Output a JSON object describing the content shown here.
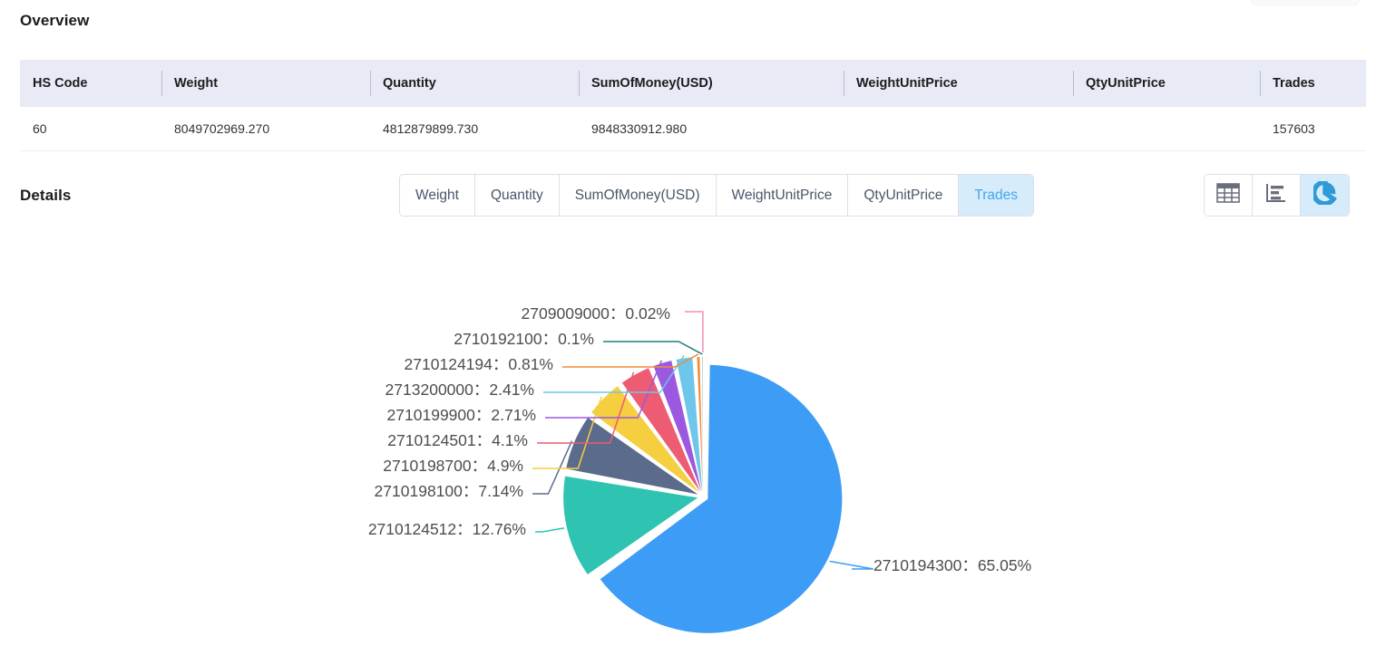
{
  "overview": {
    "title": "Overview",
    "columns": [
      "HS Code",
      "Weight",
      "Quantity",
      "SumOfMoney(USD)",
      "WeightUnitPrice",
      "QtyUnitPrice",
      "Trades"
    ],
    "rows": [
      {
        "hs_code": "60",
        "weight": "8049702969.270",
        "quantity": "4812879899.730",
        "sum_of_money_usd": "9848330912.980",
        "weight_unit_price": "",
        "qty_unit_price": "",
        "trades": "157603"
      }
    ]
  },
  "details": {
    "title": "Details",
    "metric_tabs": [
      {
        "label": "Weight",
        "active": false
      },
      {
        "label": "Quantity",
        "active": false
      },
      {
        "label": "SumOfMoney(USD)",
        "active": false
      },
      {
        "label": "WeightUnitPrice",
        "active": false
      },
      {
        "label": "QtyUnitPrice",
        "active": false
      },
      {
        "label": "Trades",
        "active": true
      }
    ],
    "view_modes": [
      {
        "icon": "table-view-icon",
        "active": false
      },
      {
        "icon": "bar-chart-view-icon",
        "active": false
      },
      {
        "icon": "pie-chart-view-icon",
        "active": true
      }
    ],
    "active_color": "#45a7e8",
    "active_bg": "#d6ecfb"
  },
  "chart_data": {
    "type": "pie",
    "title": "",
    "metric": "Trades",
    "unit": "%",
    "legend_position": "labels-with-leader-lines",
    "categories": [
      "2710194300",
      "2710124512",
      "2710198100",
      "2710198700",
      "2710124501",
      "2710199900",
      "2713200000",
      "2710124194",
      "2710192100",
      "2709009000"
    ],
    "values": [
      65.05,
      12.76,
      7.14,
      4.9,
      4.1,
      2.71,
      2.41,
      0.81,
      0.1,
      0.02
    ],
    "colors": [
      "#3d9cf5",
      "#2fc4b2",
      "#5b6b8c",
      "#f5cf3f",
      "#ed5c72",
      "#9b59e0",
      "#6ec6ea",
      "#f08c3a",
      "#18807c",
      "#f48fb1"
    ],
    "labels": [
      "2710194300：65.05%",
      "2710124512：12.76%",
      "2710198100：7.14%",
      "2710198700：4.9%",
      "2710124501：4.1%",
      "2710199900：2.71%",
      "2713200000：2.41%",
      "2710124194：0.81%",
      "2710192100：0.1%",
      "2709009000：0.02%"
    ]
  }
}
